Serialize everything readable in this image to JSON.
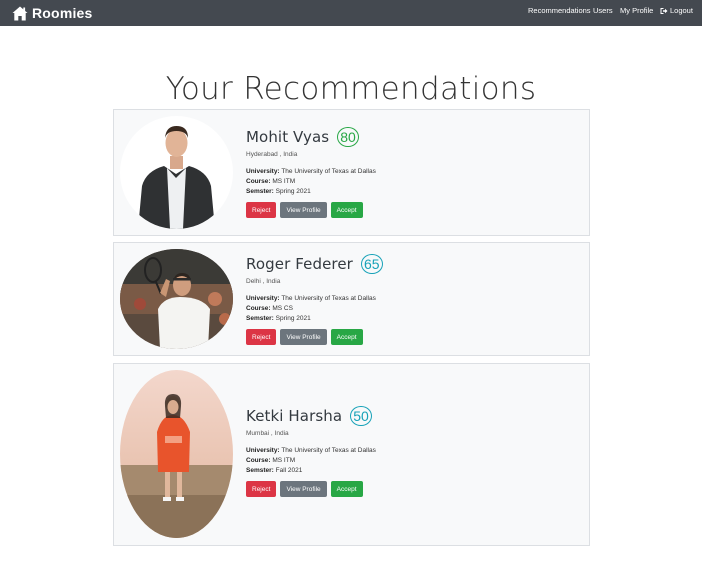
{
  "navbar": {
    "brand": "Roomies",
    "links": {
      "recommendations": "Recommendations",
      "users": "Users",
      "my_profile": "My Profile",
      "logout": "Logout"
    }
  },
  "page": {
    "title": "Your Recommendations"
  },
  "labels": {
    "university": "University:",
    "course": "Course:",
    "semester": "Semster:",
    "reject": "Reject",
    "view_profile": "View Profile",
    "accept": "Accept"
  },
  "recommendations": [
    {
      "name": "Mohit Vyas",
      "score": "80",
      "score_color": "#28a745",
      "location": "Hyderabad , India",
      "university": "The University of Texas at Dallas",
      "course": "MS ITM",
      "semester": "Spring 2021"
    },
    {
      "name": "Roger Federer",
      "score": "65",
      "score_color": "#17a2b8",
      "location": "Delhi , India",
      "university": "The University of Texas at Dallas",
      "course": "MS CS",
      "semester": "Spring 2021"
    },
    {
      "name": "Ketki Harsha",
      "score": "50",
      "score_color": "#17a2b8",
      "location": "Mumbai , India",
      "university": "The University of Texas at Dallas",
      "course": "MS ITM",
      "semester": "Fall 2021"
    }
  ],
  "colors": {
    "navbar": "#444950",
    "reject": "#dc3545",
    "view": "#6c757d",
    "accept": "#28a745"
  },
  "icons": {
    "brand": "home-icon",
    "logout": "sign-out-icon"
  }
}
